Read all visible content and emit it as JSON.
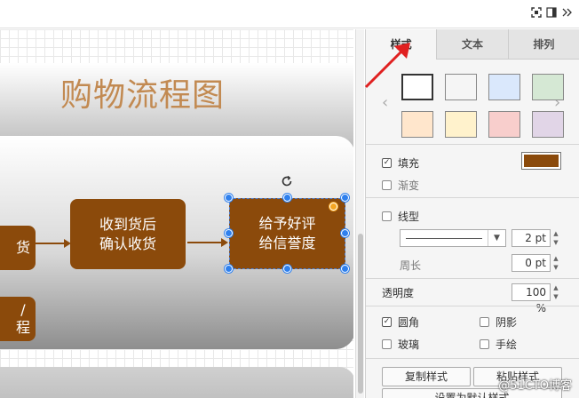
{
  "canvas": {
    "title": "购物流程图",
    "nodes": {
      "left_top": "货",
      "left_bottom_line1": "/",
      "left_bottom_line2": "程",
      "receive_line1": "收到货后",
      "receive_line2": "确认收货",
      "review_line1": "给予好评",
      "review_line2": "给信誉度"
    },
    "node_color": "#8B4A0B",
    "title_color": "#C28A52"
  },
  "panel": {
    "tabs": [
      "样式",
      "文本",
      "排列"
    ],
    "active_tab": "样式",
    "swatches": [
      "#FFFFFF",
      "#F5F5F5",
      "#DAE8FC",
      "#D5E8D4",
      "#FFE6CC",
      "#FFF2CC",
      "#F8CECC",
      "#E1D5E7"
    ],
    "fill_label": "填充",
    "fill_checked": true,
    "fill_color": "#8B4A0B",
    "gradient_label": "渐变",
    "gradient_checked": false,
    "line_label": "线型",
    "line_checked": false,
    "line_width": "2 pt",
    "perimeter_label": "周长",
    "perimeter_value": "0 pt",
    "opacity_label": "透明度",
    "opacity_value": "100 %",
    "rounded_label": "圆角",
    "rounded_checked": true,
    "shadow_label": "阴影",
    "shadow_checked": false,
    "glass_label": "玻璃",
    "glass_checked": false,
    "sketch_label": "手绘",
    "sketch_checked": false,
    "copy_style_label": "复制样式",
    "paste_style_label": "粘贴样式",
    "set_default_label": "设置为默认样式"
  },
  "watermark": "@51CTO博客"
}
